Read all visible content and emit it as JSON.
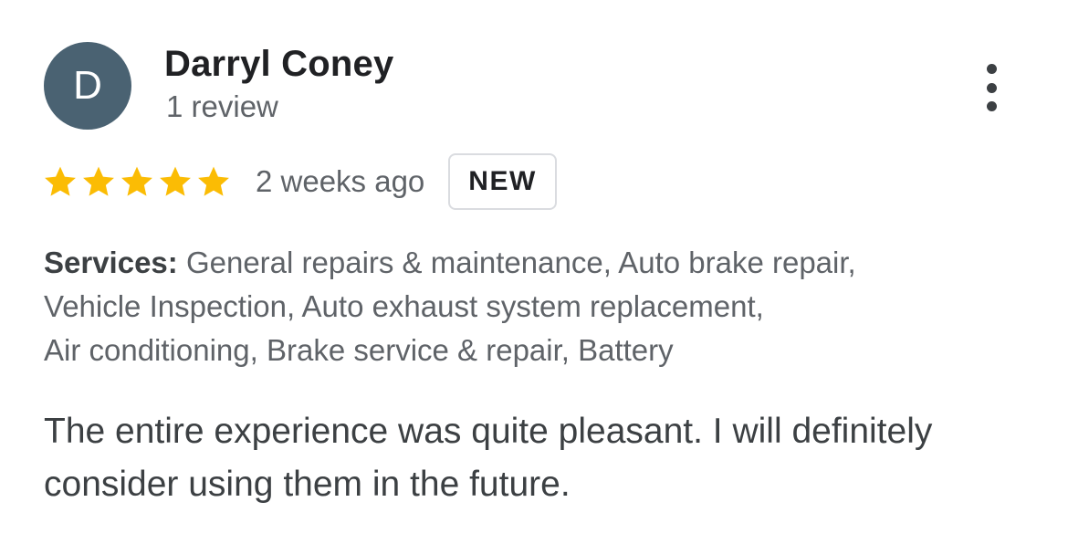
{
  "reviewer": {
    "initial": "D",
    "name": "Darryl Coney",
    "review_count": "1 review",
    "avatar_color": "#4a6272"
  },
  "menu": {
    "icon": "more-vert-icon"
  },
  "rating": {
    "stars": 5,
    "max_stars": 5,
    "star_color": "#fbbc04",
    "time": "2 weeks ago",
    "badge": "NEW"
  },
  "services": {
    "label": "Services:",
    "lines": [
      " General repairs & maintenance, Auto brake repair,",
      "Vehicle Inspection, Auto exhaust system replacement,",
      "Air conditioning, Brake service & repair, Battery"
    ]
  },
  "review": {
    "lines": [
      "The entire experience was quite pleasant. I will definitely",
      "consider using them in the future."
    ]
  }
}
